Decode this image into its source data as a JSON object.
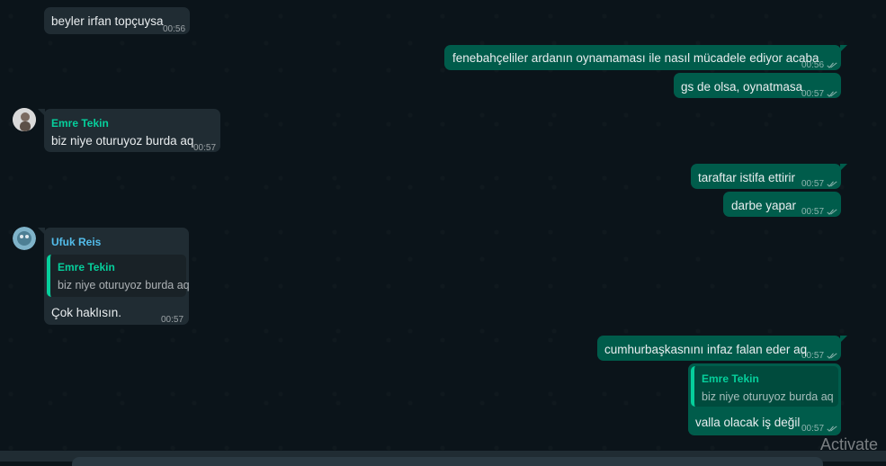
{
  "colors": {
    "background": "#0b141a",
    "incoming_bubble": "#202c33",
    "outgoing_bubble": "#005c4b",
    "sender_emre": "#06cf9c",
    "sender_ufuk": "#53bdeb",
    "timestamp": "#8696a0"
  },
  "messages": [
    {
      "direction": "in",
      "text": "beyler irfan topçuysa",
      "time": "00:56"
    },
    {
      "direction": "out",
      "text": "fenebahçeliler ardanın oynamaması ile nasıl mücadele ediyor acaba",
      "time": "00:56",
      "status_icon": "double-check-icon"
    },
    {
      "direction": "out",
      "text": "gs de olsa, oynatmasa",
      "time": "00:57",
      "status_icon": "double-check-icon"
    },
    {
      "direction": "in",
      "sender": "Emre Tekin",
      "text": "biz niye oturuyoz burda aq",
      "time": "00:57",
      "avatar_icon": "user-avatar-icon"
    },
    {
      "direction": "out",
      "text": "taraftar istifa ettirir",
      "time": "00:57",
      "status_icon": "double-check-icon"
    },
    {
      "direction": "out",
      "text": "darbe yapar",
      "time": "00:57",
      "status_icon": "double-check-icon"
    },
    {
      "direction": "in",
      "sender": "Ufuk Reis",
      "quote": {
        "sender": "Emre Tekin",
        "text": "biz niye oturuyoz burda aq"
      },
      "text": "Çok haklısın.",
      "time": "00:57",
      "avatar_icon": "user-avatar-icon"
    },
    {
      "direction": "out",
      "text": "cumhurbaşkasnını infaz falan eder aq",
      "time": "00:57",
      "status_icon": "double-check-icon"
    },
    {
      "direction": "out",
      "quote": {
        "sender": "Emre Tekin",
        "text": "biz niye oturuyoz burda aq"
      },
      "text": "valla olacak iş değil",
      "time": "00:57",
      "status_icon": "double-check-icon"
    }
  ],
  "watermark": "Activate"
}
